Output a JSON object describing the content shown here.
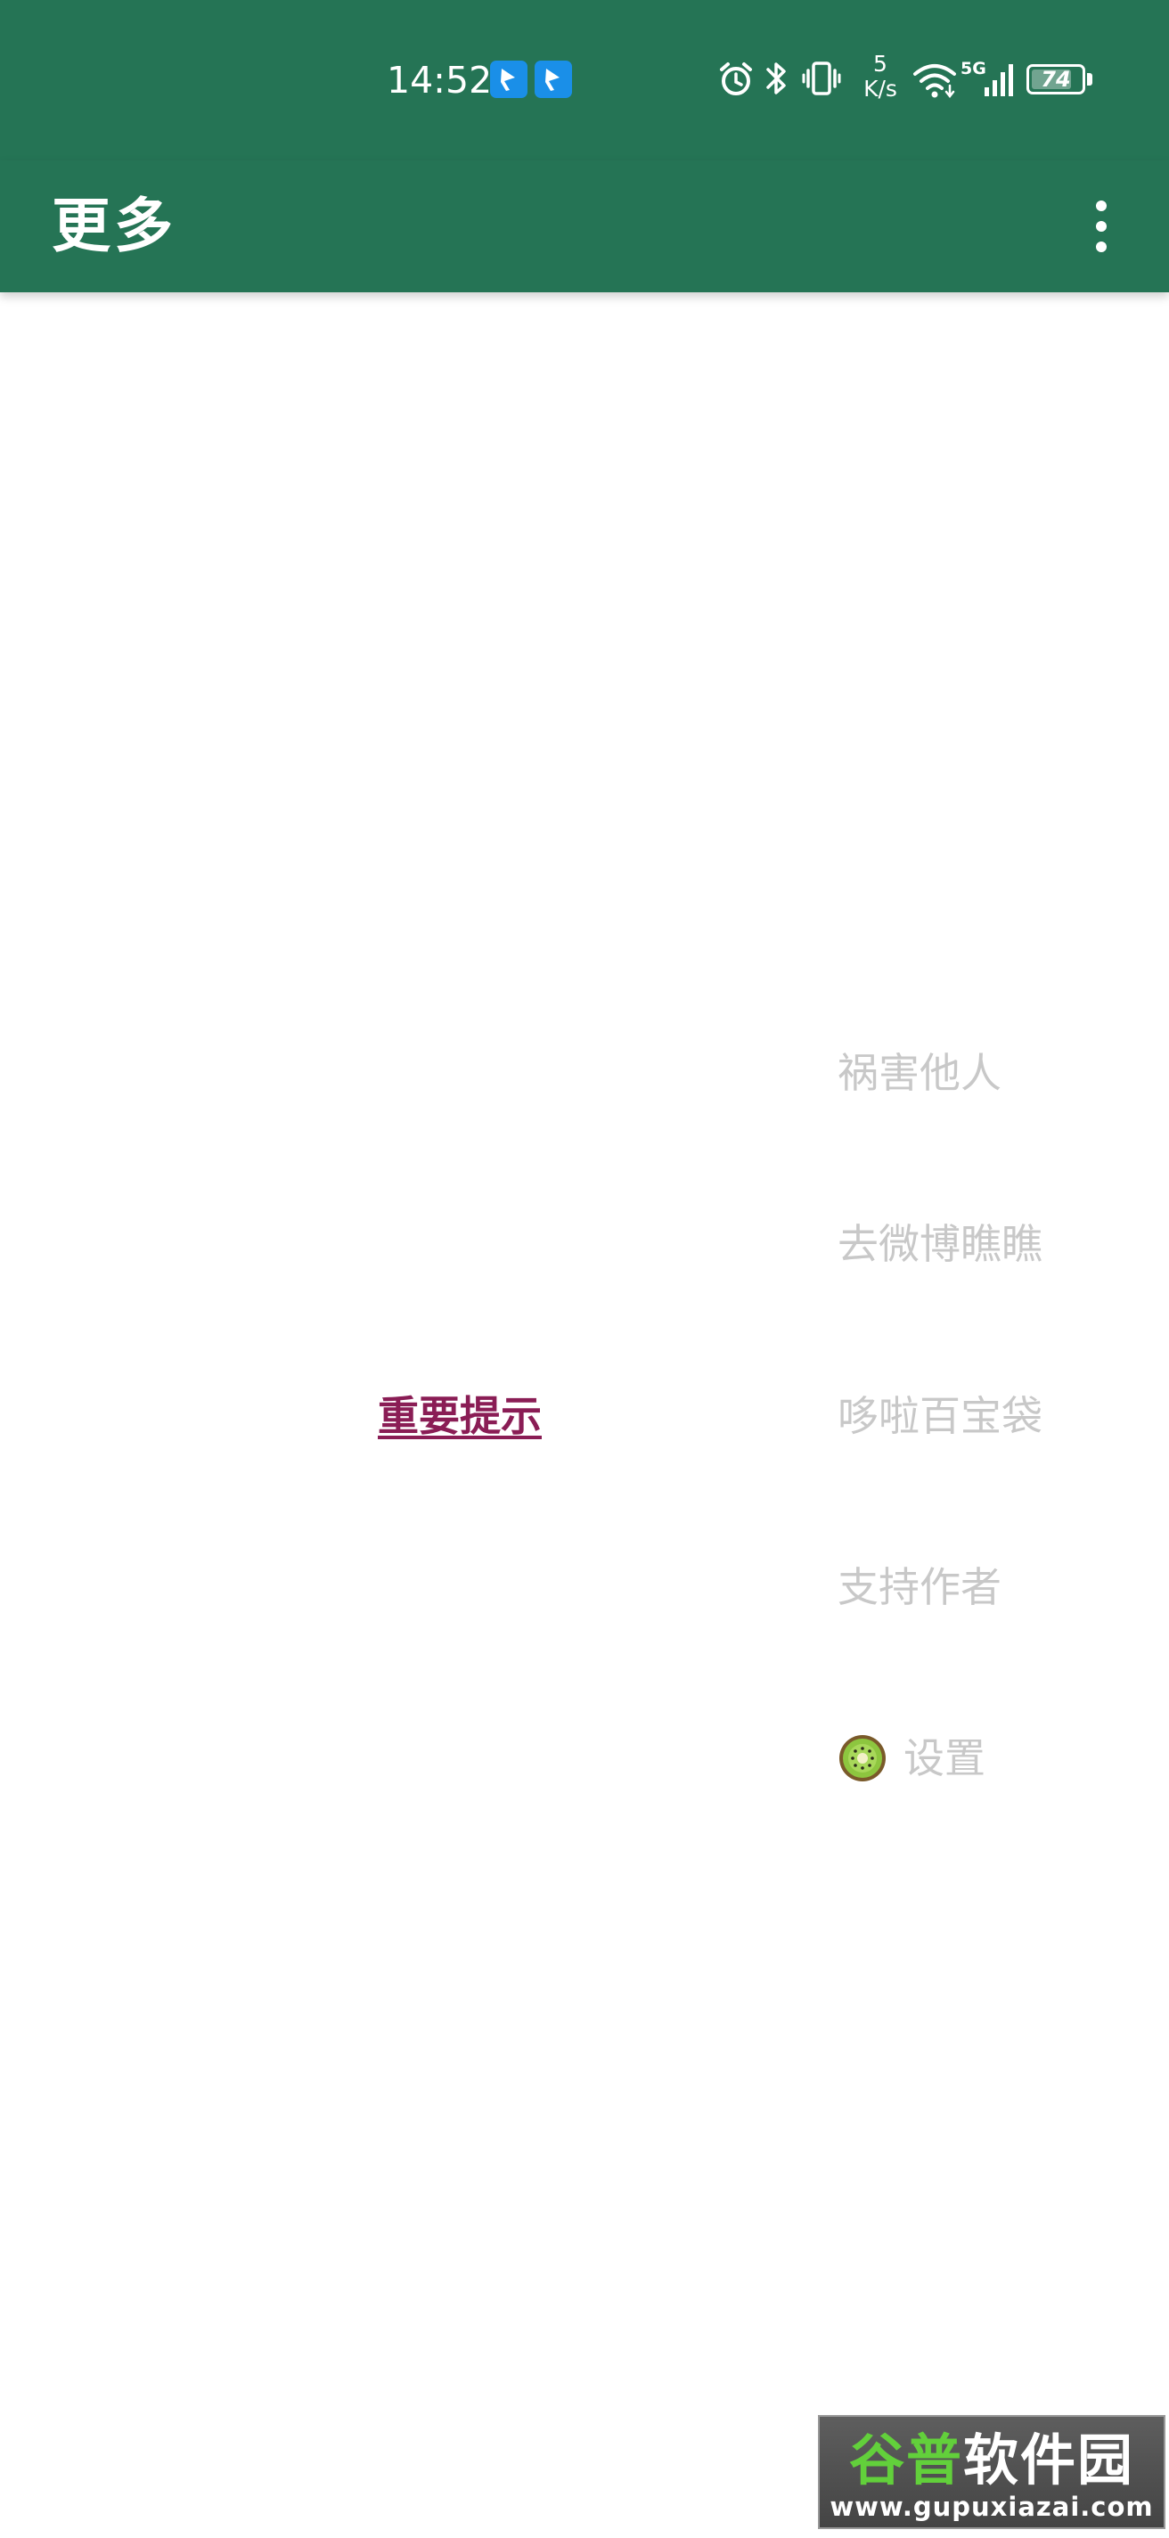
{
  "status_bar": {
    "time": "14:52",
    "notification_icons": [
      "app-notification-icon",
      "app-notification-icon"
    ],
    "icons": [
      "alarm-icon",
      "bluetooth-icon",
      "vibrate-icon",
      "wifi-icon",
      "signal-icon"
    ],
    "net_speed_value": "5",
    "net_speed_unit": "K/s",
    "network_type": "5G",
    "battery_level": "74"
  },
  "app_bar": {
    "title": "更多",
    "menu_icon": "more-vert-icon"
  },
  "main": {
    "notice_link": "重要提示",
    "menu_items": [
      {
        "label": "祸害他人"
      },
      {
        "label": "去微博瞧瞧"
      },
      {
        "label": "哆啦百宝袋"
      },
      {
        "label": "支持作者"
      },
      {
        "label": "设置",
        "icon": "kiwi-icon"
      }
    ]
  },
  "watermark": {
    "title_part1": "谷普",
    "title_part2": "软件园",
    "url": "www.gupuxiazai.com"
  },
  "colors": {
    "primary": "#257455",
    "link": "#8a1d55",
    "menu_text": "#c8c8c8",
    "background": "#ffffff"
  }
}
